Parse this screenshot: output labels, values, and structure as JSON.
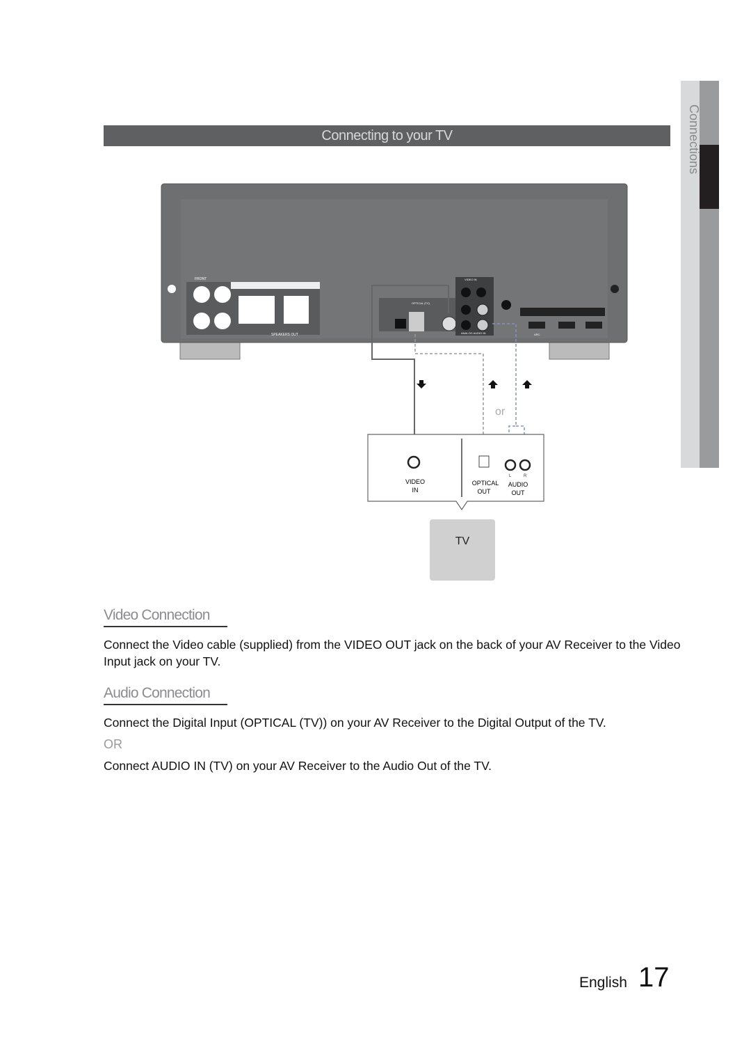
{
  "section_tab": "Connections",
  "title": "Connecting to your TV",
  "diagram": {
    "panel_labels": {
      "video_in": "VIDEO IN",
      "analog_audio_in": "ANALOG AUDIO IN",
      "optical": "OPTICAL (TV)",
      "arc": "ARC",
      "speakers_out": "SPEAKERS OUT",
      "front": "FRONT"
    },
    "or_label": "or",
    "tv_video_in": [
      "VIDEO",
      "IN"
    ],
    "tv_optical_out": [
      "OPTICAL",
      "OUT"
    ],
    "tv_audio_out": [
      "AUDIO",
      "OUT"
    ],
    "channel_left": "L",
    "channel_right": "R",
    "tv_label": "TV"
  },
  "video_connection": {
    "heading": "Video Connection",
    "body": "Connect the Video cable (supplied) from the VIDEO OUT jack on the back of your AV Receiver to the Video Input jack on your TV."
  },
  "audio_connection": {
    "heading": "Audio Connection",
    "option1": "Connect the Digital Input (OPTICAL (TV)) on your AV Receiver to the Digital Output of the TV.",
    "or": "OR",
    "option2": "Connect AUDIO IN (TV) on your AV Receiver to the Audio Out of the TV."
  },
  "footer": {
    "language": "English",
    "page_number": "17"
  }
}
